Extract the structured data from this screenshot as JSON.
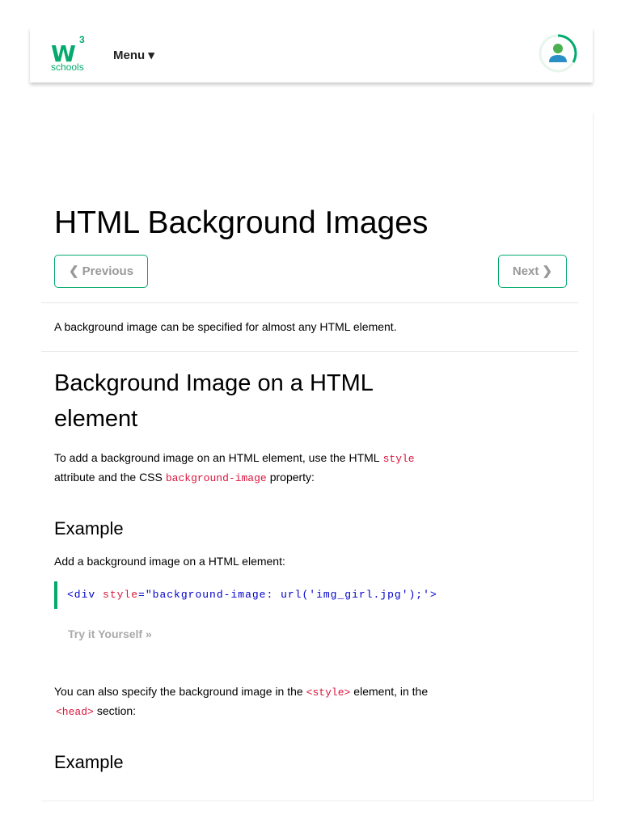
{
  "header": {
    "logo_top": "W",
    "logo_sup": "3",
    "logo_sub": "schools",
    "menu": "Menu ▾"
  },
  "page": {
    "title": "HTML Background Images",
    "prev": "❮ Previous",
    "next": "Next ❯",
    "intro": "A background image can be specified for almost any HTML element.",
    "h2": "Background Image on a HTML element",
    "p1a": "To add a background image on an HTML element, use the HTML",
    "p1code1": "style",
    "p1b": "attribute and the CSS",
    "p1code2": "background-image",
    "p1c": "property:",
    "example1": "Example",
    "example1_desc": "Add a background image on a HTML element:",
    "code_tag": "<div",
    "code_attr": "style",
    "code_val": "=\"background-image: url('img_girl.jpg');'>",
    "try": "Try it Yourself »",
    "p2a": "You can also specify the background image in the",
    "p2code1": "<style>",
    "p2b": "element, in the",
    "p2code2": "<head>",
    "p2c": "section:",
    "example2": "Example"
  },
  "colors": {
    "brand": "#04AA6D",
    "code": "#dc143c"
  }
}
